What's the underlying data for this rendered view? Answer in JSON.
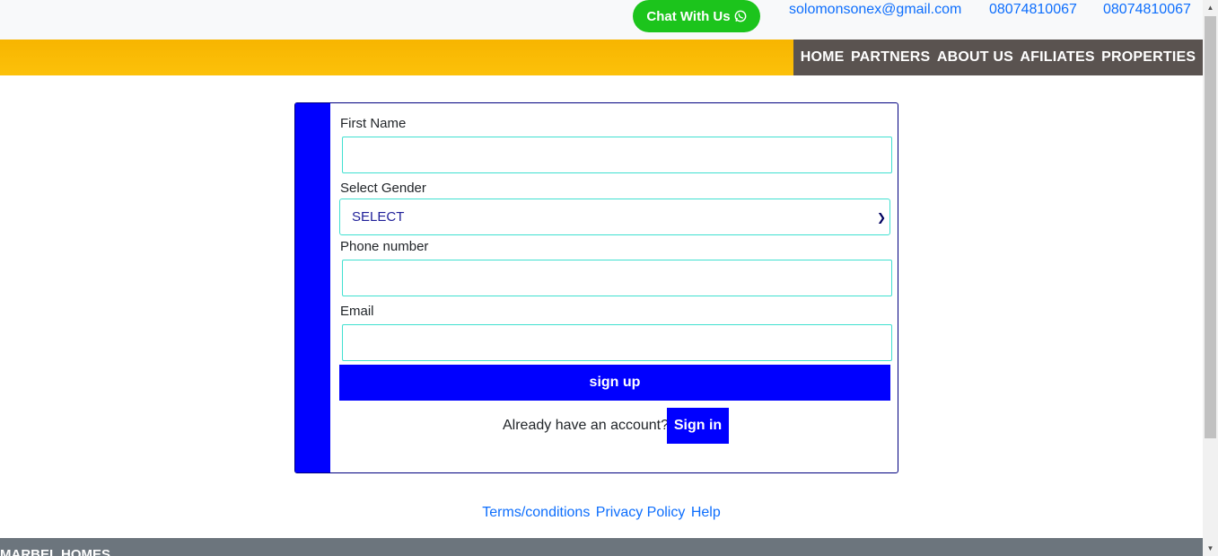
{
  "topbar": {
    "chat_label": "Chat With Us",
    "email": "solomonsonex@gmail.com",
    "phone1": "08074810067",
    "phone2": "08074810067"
  },
  "nav": {
    "items": [
      "HOME",
      "PARTNERS",
      "ABOUT US",
      "AFILIATES",
      "PROPERTIES"
    ]
  },
  "form": {
    "first_name_label": "First Name",
    "first_name_value": "",
    "gender_label": "Select Gender",
    "gender_selected": "SELECT",
    "phone_label": "Phone number",
    "phone_value": "",
    "email_label": "Email",
    "email_value": "",
    "signup_label": "sign up",
    "have_account_text": "Already have an account?",
    "signin_label": "Sign in"
  },
  "footer_links": {
    "terms": "Terms/conditions",
    "privacy": "Privacy Policy",
    "help": "Help"
  },
  "footer": {
    "brand": "MARBEL HOMES"
  },
  "colors": {
    "accent_blue": "#0000ff",
    "nav_yellow": "#fcc10a",
    "nav_dark": "#5a5350",
    "whatsapp_green": "#1cc41c",
    "link_blue": "#0d6efd",
    "input_border": "#40e0d0"
  },
  "icons": {
    "chat": "whatsapp-icon",
    "select": "chevron-down-icon"
  }
}
